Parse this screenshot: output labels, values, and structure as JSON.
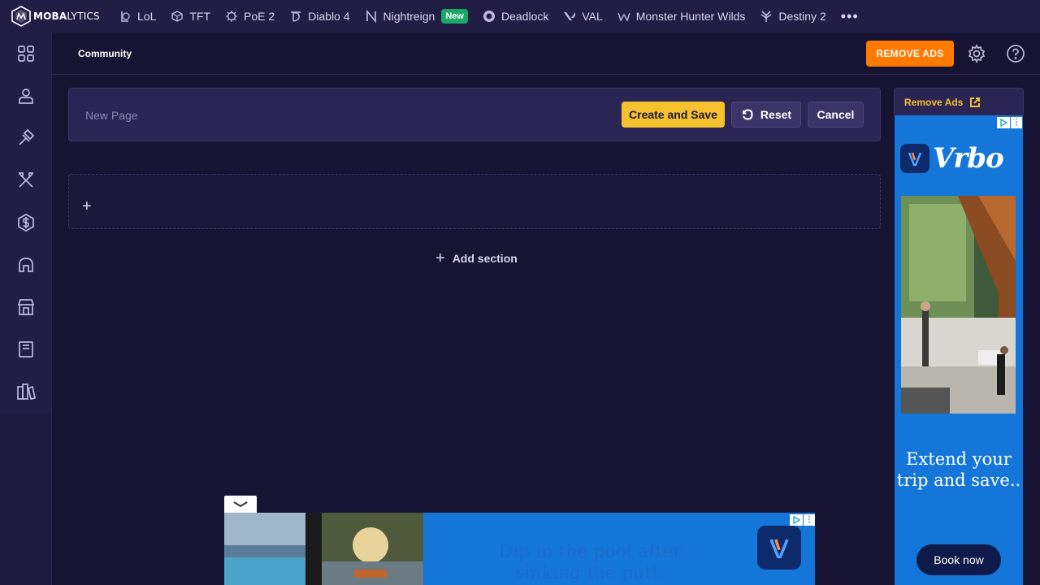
{
  "brand": {
    "name_bold": "MOBA",
    "name_thin": "LYTICS"
  },
  "top_nav": {
    "games": [
      {
        "label": "LoL",
        "icon": "lol-icon"
      },
      {
        "label": "TFT",
        "icon": "tft-icon"
      },
      {
        "label": "PoE 2",
        "icon": "poe-icon"
      },
      {
        "label": "Diablo 4",
        "icon": "diablo-icon"
      },
      {
        "label": "Nightreign",
        "icon": "nightreign-icon",
        "badge": "New"
      },
      {
        "label": "Deadlock",
        "icon": "deadlock-icon"
      },
      {
        "label": "VAL",
        "icon": "valorant-icon"
      },
      {
        "label": "Monster Hunter Wilds",
        "icon": "monster-hunter-icon"
      },
      {
        "label": "Destiny 2",
        "icon": "destiny-icon"
      }
    ],
    "more": "more-icon"
  },
  "side_nav": {
    "items": [
      "apps-grid-icon",
      "profile-icon",
      "hammer-icon",
      "swords-icon",
      "coin-icon",
      "helmet-icon",
      "store-icon",
      "book-icon",
      "library-icon"
    ]
  },
  "header": {
    "breadcrumb": "Community",
    "remove_ads_label": "REMOVE ADS",
    "settings_icon": "gear-icon",
    "help_icon": "help-icon"
  },
  "editor": {
    "title_placeholder": "New Page",
    "title_value": "",
    "create_label": "Create and Save",
    "reset_label": "Reset",
    "cancel_label": "Cancel"
  },
  "canvas": {
    "add_section_label": "Add section"
  },
  "side_ad": {
    "header_label": "Remove Ads",
    "brand": "Vrbo",
    "headline": "Extend your trip and save..",
    "cta": "Book now"
  },
  "bottom_ad": {
    "text": "Dip in the pool after sinking the putt."
  },
  "colors": {
    "background": "#171332",
    "nav": "#211d45",
    "accent_orange": "#ff7a00",
    "accent_yellow": "#f5c12e",
    "badge_green": "#1aa768",
    "ad_blue": "#1576d9"
  }
}
